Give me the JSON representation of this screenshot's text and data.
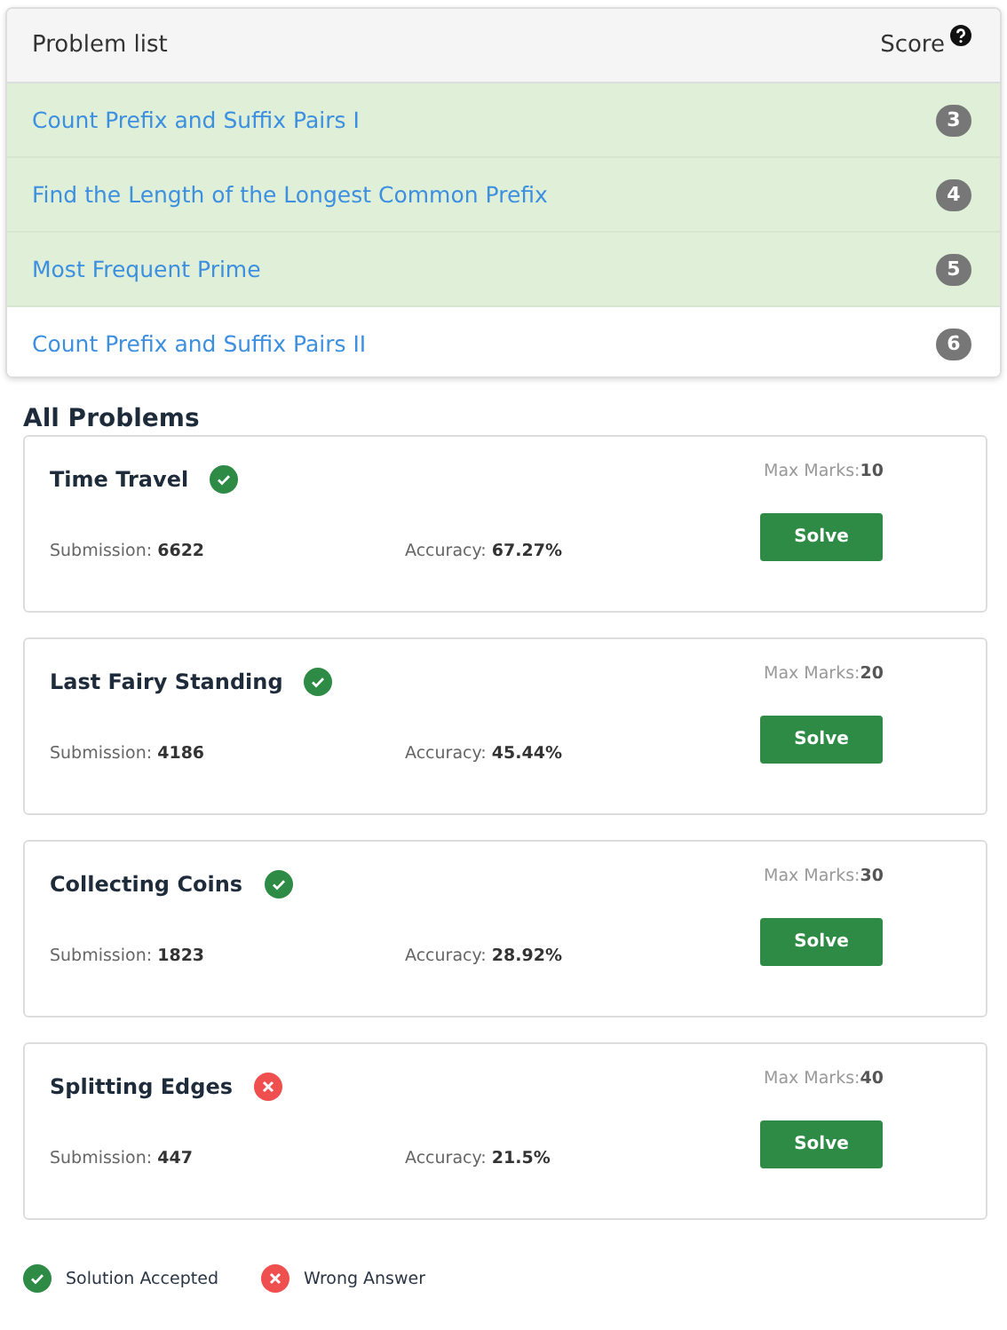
{
  "problem_list": {
    "title": "Problem list",
    "score_label": "Score",
    "items": [
      {
        "name": "Count Prefix and Suffix Pairs I",
        "score": "3",
        "solved": true
      },
      {
        "name": "Find the Length of the Longest Common Prefix",
        "score": "4",
        "solved": true
      },
      {
        "name": "Most Frequent Prime",
        "score": "5",
        "solved": true
      },
      {
        "name": "Count Prefix and Suffix Pairs II",
        "score": "6",
        "solved": false
      }
    ]
  },
  "all_problems": {
    "title": "All Problems",
    "cards": [
      {
        "title": "Time Travel",
        "kind": "accepted",
        "max_marks_label": "Max Marks:",
        "max_marks": "10",
        "submission_label": "Submission:",
        "submission": "6622",
        "accuracy_label": "Accuracy:",
        "accuracy": "67.27%",
        "button": "Solve"
      },
      {
        "title": "Last Fairy Standing",
        "kind": "accepted",
        "max_marks_label": "Max Marks:",
        "max_marks": "20",
        "submission_label": "Submission:",
        "submission": "4186",
        "accuracy_label": "Accuracy:",
        "accuracy": "45.44%",
        "button": "Solve"
      },
      {
        "title": "Collecting Coins",
        "kind": "accepted",
        "max_marks_label": "Max Marks:",
        "max_marks": "30",
        "submission_label": "Submission:",
        "submission": "1823",
        "accuracy_label": "Accuracy:",
        "accuracy": "28.92%",
        "button": "Solve"
      },
      {
        "title": "Splitting Edges",
        "kind": "wrong",
        "max_marks_label": "Max Marks:",
        "max_marks": "40",
        "submission_label": "Submission:",
        "submission": "447",
        "accuracy_label": "Accuracy:",
        "accuracy": "21.5%",
        "button": "Solve"
      }
    ]
  },
  "legend": [
    {
      "kind": "accepted",
      "label": "Solution Accepted"
    },
    {
      "kind": "wrong",
      "label": "Wrong Answer"
    }
  ]
}
